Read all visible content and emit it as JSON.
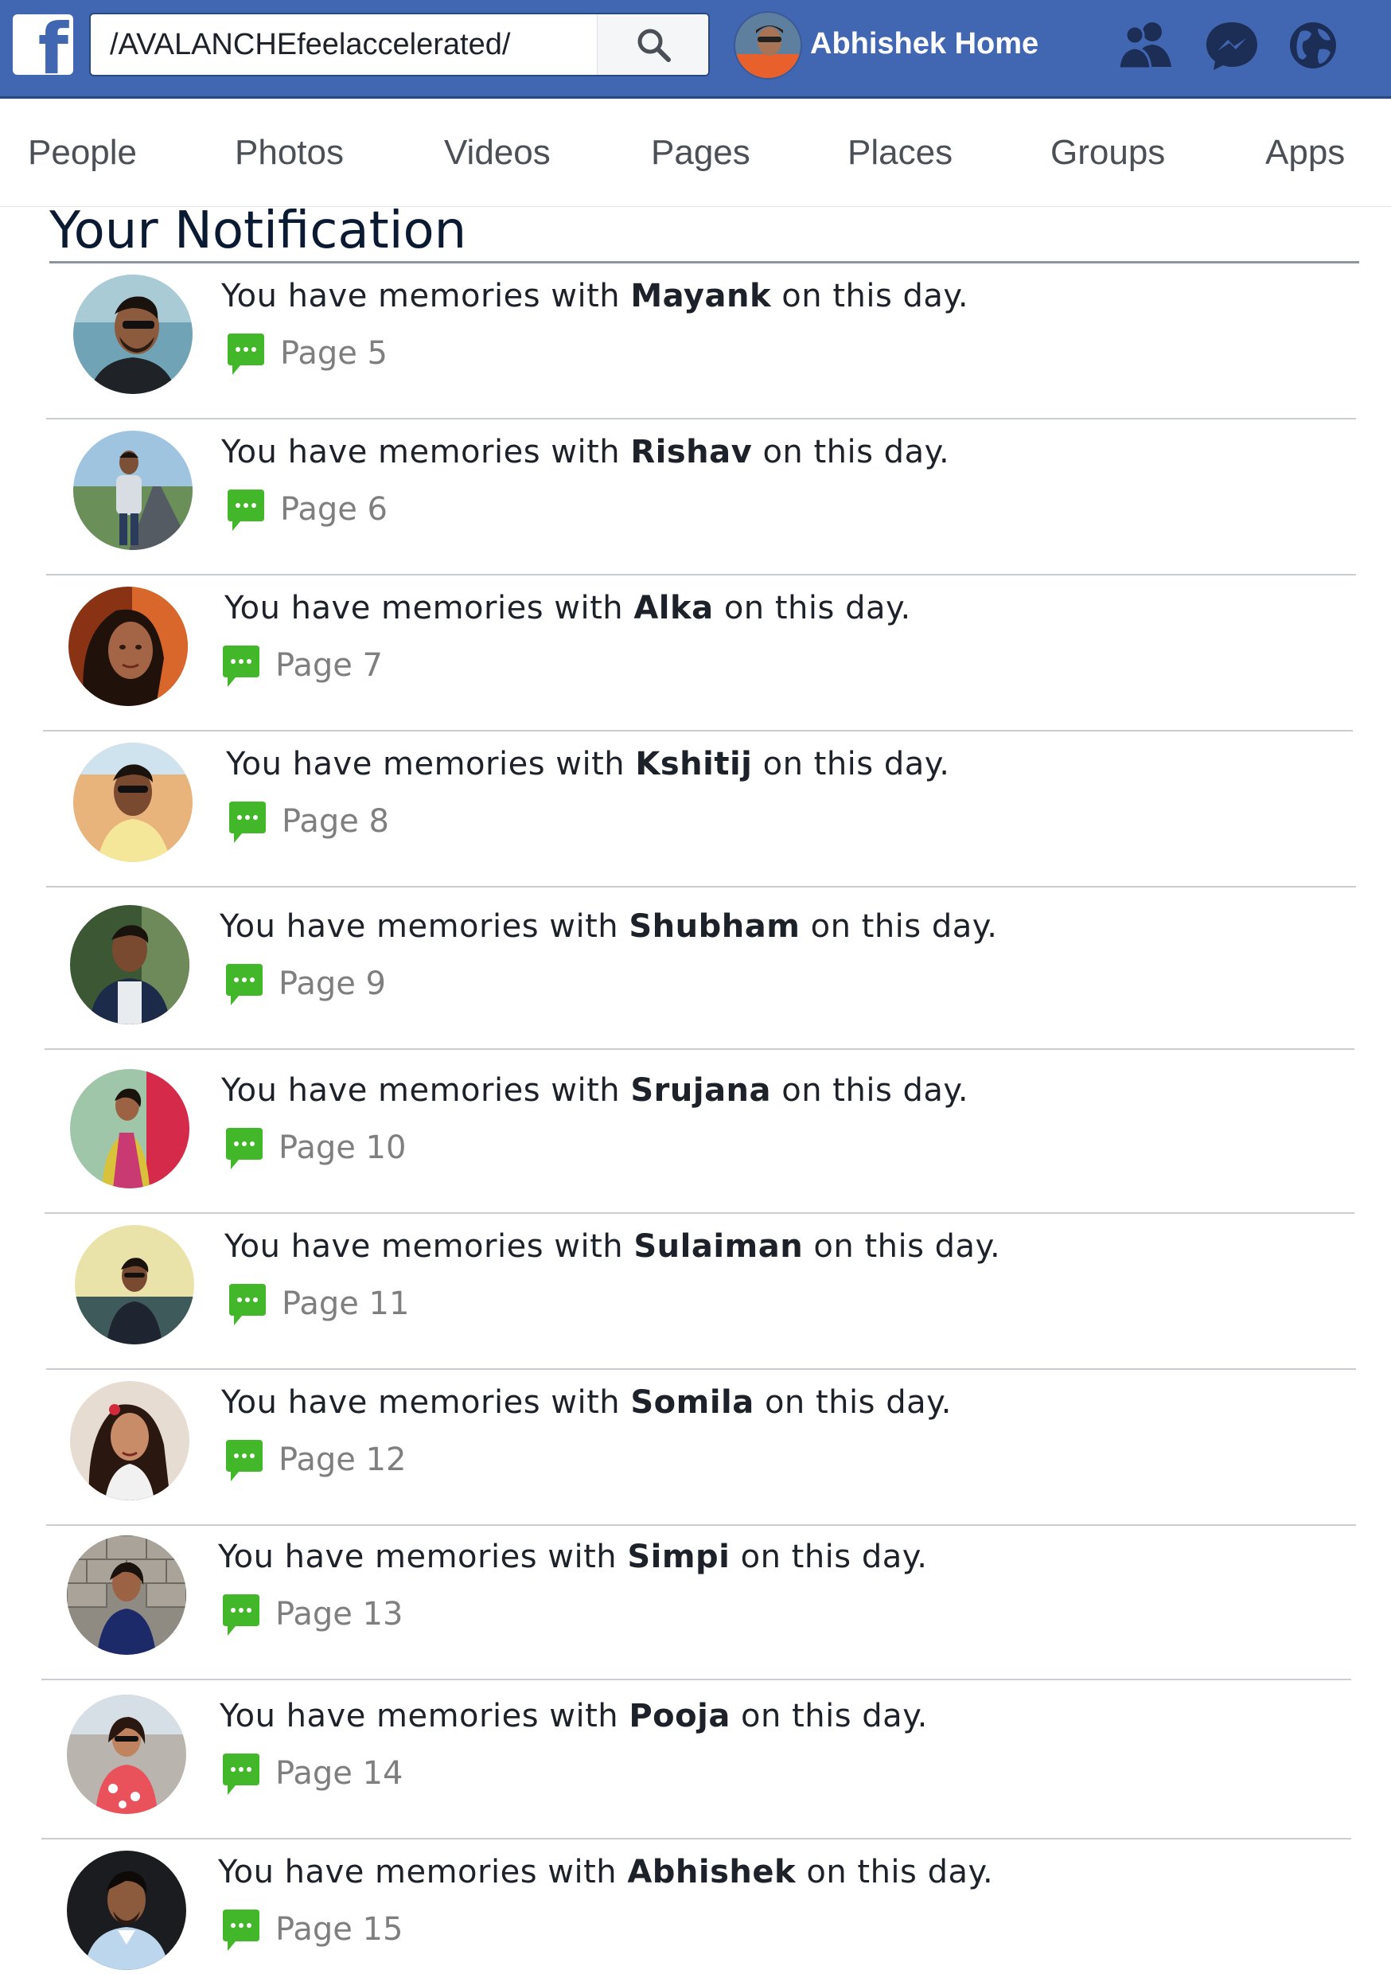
{
  "topbar": {
    "logo_letter": "f",
    "search_value": "/AVALANCHEfeelaccelerated/",
    "profile_name": "Abhishek",
    "home_label": "Home",
    "icons": [
      "friends-icon",
      "messenger-icon",
      "globe-icon",
      "search-icon"
    ],
    "colors": {
      "bar": "#4267b2",
      "bar_border": "#29487d",
      "white": "#ffffff"
    }
  },
  "tabs": [
    "People",
    "Photos",
    "Videos",
    "Pages",
    "Places",
    "Groups",
    "Apps"
  ],
  "heading": "Your Notification",
  "notification_prefix": "You have memories with",
  "notification_suffix": "on this day.",
  "notifications": [
    {
      "name": "Mayank",
      "page": "Page 5"
    },
    {
      "name": "Rishav",
      "page": "Page 6"
    },
    {
      "name": "Alka",
      "page": "Page 7"
    },
    {
      "name": "Kshitij",
      "page": "Page 8"
    },
    {
      "name": "Shubham",
      "page": "Page 9"
    },
    {
      "name": "Srujana",
      "page": "Page 10"
    },
    {
      "name": "Sulaiman",
      "page": "Page 11"
    },
    {
      "name": "Somila",
      "page": "Page 12"
    },
    {
      "name": "Simpi",
      "page": "Page 13"
    },
    {
      "name": "Pooja",
      "page": "Page 14"
    },
    {
      "name": "Abhishek",
      "page": "Page 15"
    }
  ],
  "accent_colors": {
    "comment_icon": "#42b72a",
    "page_text": "#7f7f7f"
  }
}
